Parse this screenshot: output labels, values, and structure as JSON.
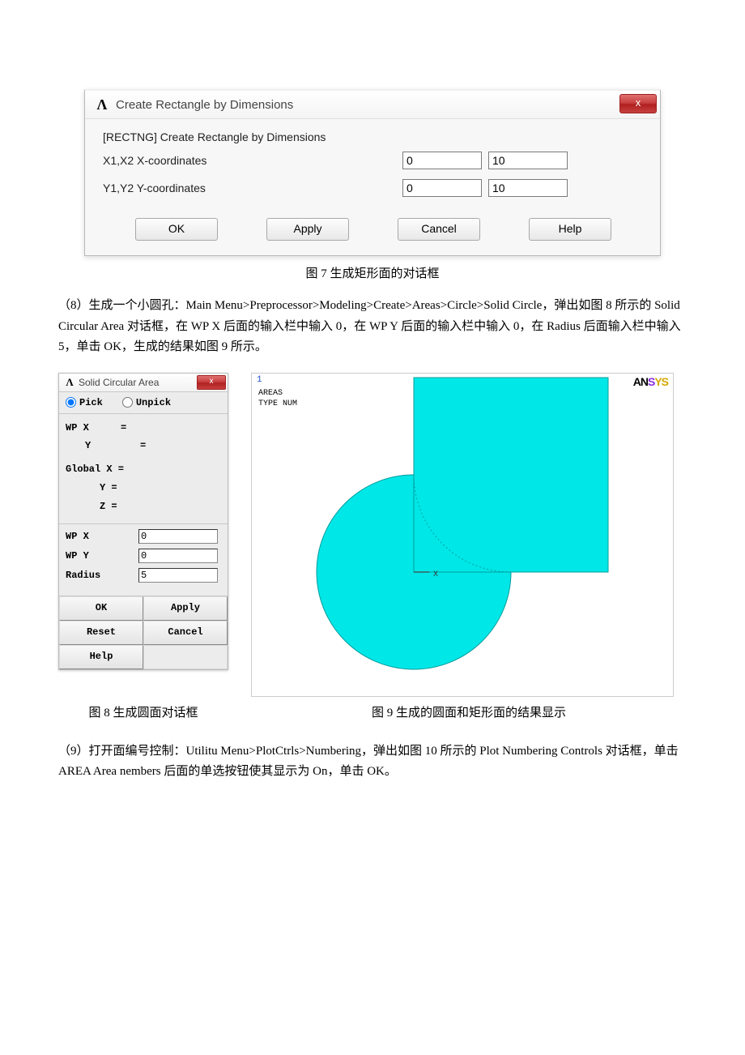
{
  "dialog7": {
    "title": "Create Rectangle by Dimensions",
    "cmd_label": "[RECTNG]  Create Rectangle by Dimensions",
    "row_x_label": "X1,X2  X-coordinates",
    "row_y_label": "Y1,Y2  Y-coordinates",
    "x1": "0",
    "x2": "10",
    "y1": "0",
    "y2": "10",
    "buttons": {
      "ok": "OK",
      "apply": "Apply",
      "cancel": "Cancel",
      "help": "Help"
    },
    "close_glyph": "x"
  },
  "caption7": "图 7   生成矩形面的对话框",
  "paragraph8": "（8）生成一个小圆孔：Main Menu>Preprocessor>Modeling>Create>Areas>Circle>Solid Circle，弹出如图 8 所示的 Solid Circular Area 对话框，在 WP X 后面的输入栏中输入 0，在 WP Y 后面的输入栏中输入 0，在 Radius 后面输入栏中输入 5，单击 OK，生成的结果如图 9 所示。",
  "dialog8": {
    "title": "Solid Circular Area",
    "pick_label": "Pick",
    "unpick_label": "Unpick",
    "coords": {
      "wp_x": "WP X",
      "wp_y": "Y",
      "gx": "Global X =",
      "gy": "Y =",
      "gz": "Z ="
    },
    "inputs": {
      "wp_x_label": "WP X",
      "wp_x_val": "0",
      "wp_y_label": "WP Y",
      "wp_y_val": "0",
      "radius_label": "Radius",
      "radius_val": "5"
    },
    "buttons": {
      "ok": "OK",
      "apply": "Apply",
      "reset": "Reset",
      "cancel": "Cancel",
      "help": "Help"
    },
    "close_glyph": "x"
  },
  "viewport9": {
    "top_num": "1",
    "label1": "AREAS",
    "label2": "TYPE NUM",
    "brand": {
      "a": "AN",
      "n": "S",
      "s": "YS"
    },
    "xlabel": "X"
  },
  "caption8": "图 8   生成圆面对话框",
  "caption9": "图 9   生成的圆面和矩形面的结果显示",
  "paragraph9": "（9）打开面编号控制：Utilitu Menu>PlotCtrls>Numbering，弹出如图 10 所示的 Plot Numbering Controls 对话框，单击 AREA Area nembers 后面的单选按钮使其显示为 On，单击 OK。",
  "chart_data": {
    "type": "area",
    "title": "AREAS / TYPE NUM",
    "shapes": [
      {
        "kind": "rectangle",
        "x1": 0,
        "y1": 0,
        "x2": 10,
        "y2": 10,
        "fill": "#00e7e7"
      },
      {
        "kind": "circle",
        "cx": 0,
        "cy": 0,
        "radius": 5,
        "fill": "#00e7e7"
      }
    ],
    "axis_marker": "X at origin",
    "xlim": [
      -5,
      10
    ],
    "ylim": [
      -5,
      10
    ]
  }
}
